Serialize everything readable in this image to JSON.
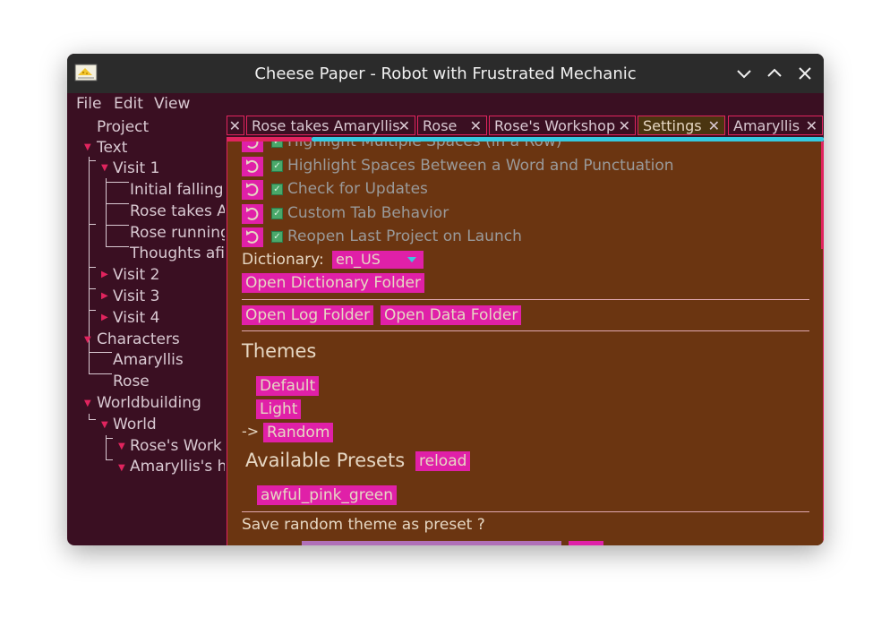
{
  "window": {
    "title": "Cheese Paper - Robot with Frustrated Mechanic"
  },
  "menu": [
    "File",
    "Edit",
    "View"
  ],
  "tree": {
    "project": "Project",
    "text": "Text",
    "visit1": "Visit 1",
    "visit1_children": [
      "Initial falling",
      "Rose takes A",
      "Rose running",
      "Thoughts afi"
    ],
    "visit2": "Visit 2",
    "visit3": "Visit 3",
    "visit4": "Visit 4",
    "characters": "Characters",
    "characters_children": [
      "Amaryllis",
      "Rose"
    ],
    "worldbuilding": "Worldbuilding",
    "world": "World",
    "world_children": [
      "Rose's Work",
      "Amaryllis's h"
    ]
  },
  "tabs": [
    {
      "label": "Rose takes Amaryllis",
      "active": false
    },
    {
      "label": "Rose",
      "active": false
    },
    {
      "label": "Rose's Workshop",
      "active": false
    },
    {
      "label": "Settings",
      "active": true
    },
    {
      "label": "Amaryllis",
      "active": false
    }
  ],
  "settings": {
    "options": [
      "Highlight Multiple Spaces (in a Row)",
      "Highlight Spaces Between a Word and Punctuation",
      "Check for Updates",
      "Custom Tab Behavior",
      "Reopen Last Project on Launch"
    ],
    "dictionary_label": "Dictionary:",
    "dictionary_value": "en_US",
    "open_dictionary_folder": "Open Dictionary Folder",
    "open_log_folder": "Open Log Folder",
    "open_data_folder": "Open Data Folder",
    "themes_heading": "Themes",
    "themes": [
      "Default",
      "Light",
      "Random"
    ],
    "selected_marker": "->",
    "presets_heading": "Available Presets",
    "reload": "reload",
    "presets": [
      "awful_pink_green"
    ],
    "save_random_prompt": "Save random theme as preset ?"
  },
  "colors": {
    "accent_pink": "#e020a8",
    "border_red": "#e0245e",
    "scroll_cyan": "#35c9e0",
    "panel_brown": "#6b3511",
    "sidebar_bg": "#3a0f22"
  }
}
